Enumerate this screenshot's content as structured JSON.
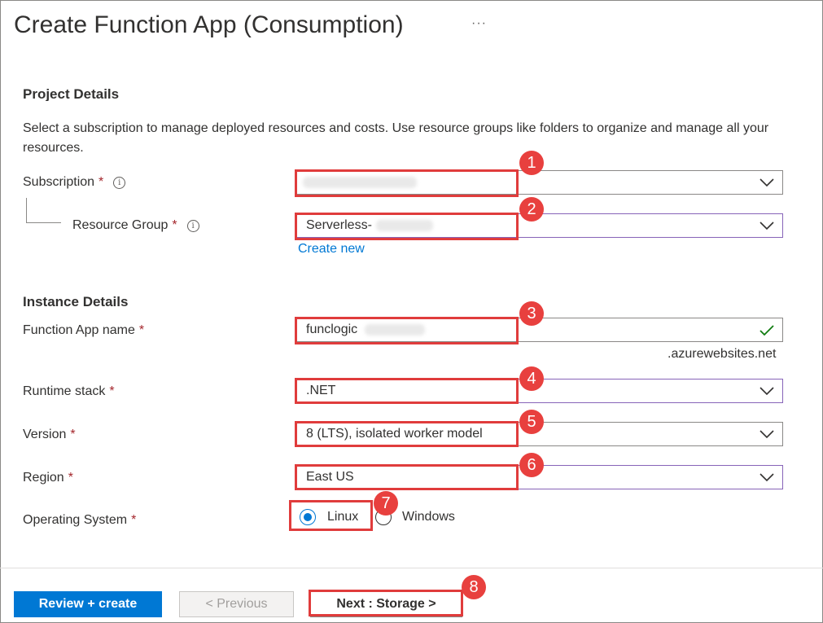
{
  "page": {
    "title": "Create Function App (Consumption)",
    "more_label": "···"
  },
  "project": {
    "heading": "Project Details",
    "description": "Select a subscription to manage deployed resources and costs. Use resource groups like folders to organize and manage all your resources.",
    "subscription_label": "Subscription",
    "subscription_value": "",
    "resource_group_label": "Resource Group",
    "resource_group_value": "Serverless-",
    "create_new_label": "Create new"
  },
  "instance": {
    "heading": "Instance Details",
    "function_app_name_label": "Function App name",
    "function_app_name_value": "funclogic",
    "domain_suffix": ".azurewebsites.net",
    "runtime_label": "Runtime stack",
    "runtime_value": ".NET",
    "version_label": "Version",
    "version_value": "8 (LTS), isolated worker model",
    "region_label": "Region",
    "region_value": "East US",
    "os_label": "Operating System",
    "os_options": [
      "Linux",
      "Windows"
    ],
    "os_selected": "Linux"
  },
  "common": {
    "required_marker": "*",
    "info_glyph": "i"
  },
  "annotations": [
    "1",
    "2",
    "3",
    "4",
    "5",
    "6",
    "7",
    "8"
  ],
  "footer": {
    "review_label": "Review + create",
    "previous_label": "< Previous",
    "next_label": "Next : Storage >"
  },
  "colors": {
    "accent": "#0078d4",
    "annotation_red": "#e8403e",
    "required": "#a4262c",
    "focus_purple": "#8764b8",
    "valid_green": "#107c10"
  },
  "icons": {
    "dropdown": "chevron-down-icon",
    "info": "info-icon",
    "valid": "checkmark-icon"
  }
}
